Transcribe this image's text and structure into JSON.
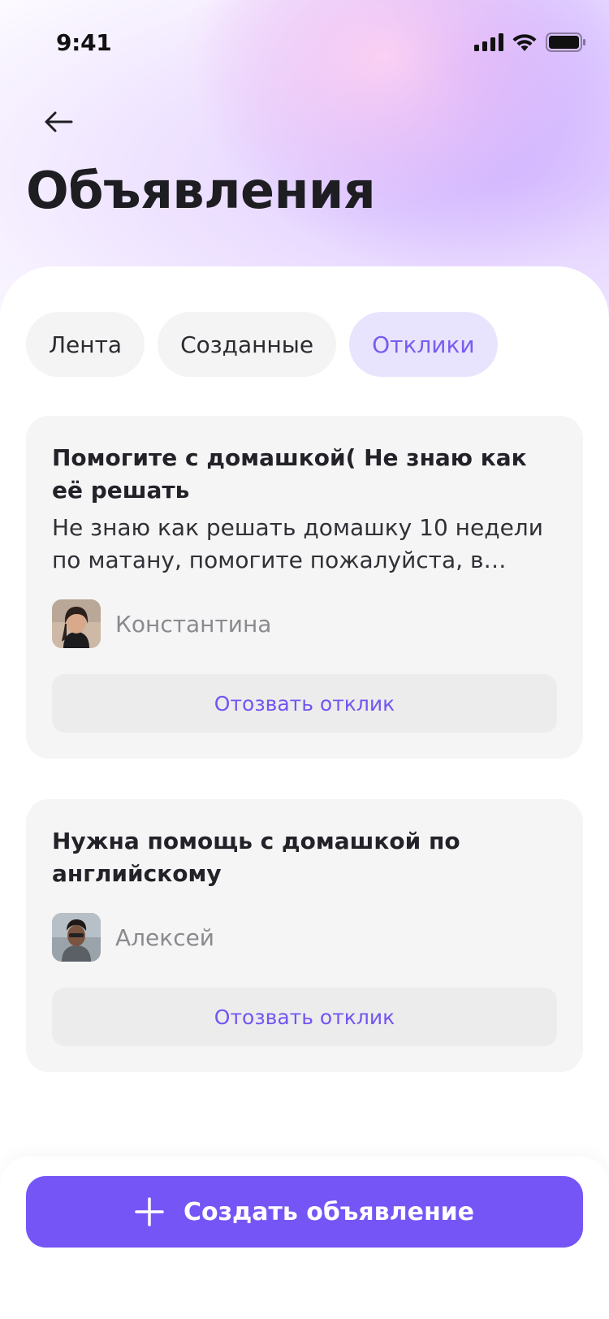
{
  "status_bar": {
    "time": "9:41"
  },
  "header": {
    "title": "Объявления"
  },
  "tabs": [
    {
      "label": "Лента",
      "active": false
    },
    {
      "label": "Созданные",
      "active": false
    },
    {
      "label": "Отклики",
      "active": true
    }
  ],
  "cards": [
    {
      "title": "Помогите с домашкой( Не знаю как её решать",
      "description": "Не знаю как решать домашку 10 недели по матану, помогите пожалуйста, в долгу не останусь",
      "author": "Константина",
      "action_label": "Отозвать отклик"
    },
    {
      "title": "Нужна помощь с домашкой по английскому",
      "author": "Алексей",
      "action_label": "Отозвать отклик"
    }
  ],
  "primary_action": {
    "label": "Создать объявление"
  },
  "colors": {
    "accent": "#7655F7",
    "active_tab_bg": "#E9E4FD",
    "card_bg": "#F5F5F6"
  },
  "icons": [
    "back-arrow-icon",
    "signal-icon",
    "wifi-icon",
    "battery-icon",
    "plus-icon"
  ]
}
